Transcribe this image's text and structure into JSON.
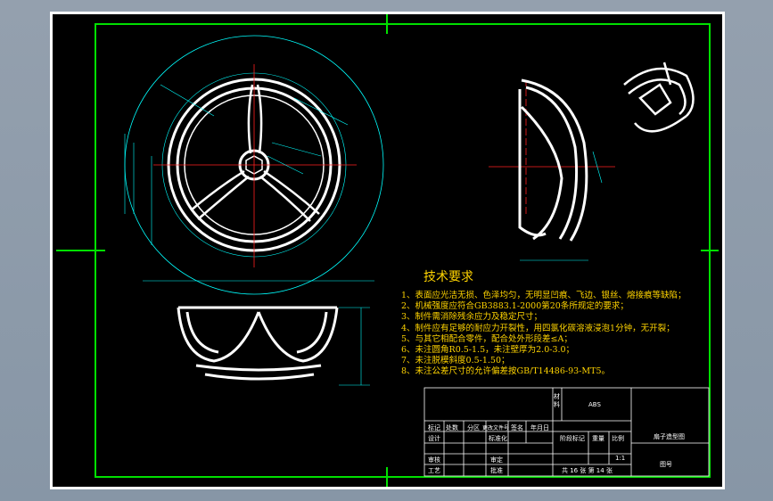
{
  "requirements": {
    "title": "技术要求",
    "items": [
      "1、表面应光洁无损、色泽均匀，无明显凹痕、飞边、银丝、熔接痕等缺陷；",
      "2、机械强度应符合GB3883.1-2000第20条所规定的要求；",
      "3、制件需消除残余应力及稳定尺寸；",
      "4、制件应有足够的耐应力开裂性，用四氯化碳溶液浸泡1分钟，无开裂；",
      "5、与其它相配合零件，配合处外形段差≤A；",
      "6、未注圆角R0.5-1.5，未注壁厚为2.0-3.0；",
      "7、未注脱模斜度0.5-1.50；",
      "8、未注公差尺寸的允许偏差按GB/T14486-93-MT5。"
    ]
  },
  "title_block": {
    "material_label": "材料",
    "material": "ABS",
    "part_name": "扇子造型图",
    "drawing_no_label": "图号",
    "stage_mark_label": "阶段标记",
    "weight_label": "重量",
    "scale_label": "比例",
    "scale": "1:1",
    "sheet_info": "共 16 张 第 14 张",
    "row_labels": [
      "标记",
      "设计",
      "审核",
      "工艺"
    ],
    "header_labels": [
      "处数",
      "分区",
      "更改文件号",
      "签名",
      "年月日"
    ],
    "std_label": "标准化",
    "approve_label": "批准",
    "check_label": "审定"
  }
}
